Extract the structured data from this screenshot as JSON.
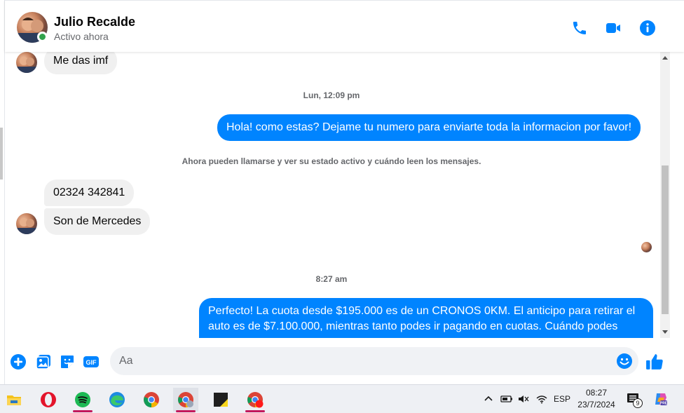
{
  "header": {
    "contact_name": "Julio Recalde",
    "status": "Activo ahora"
  },
  "messages": {
    "first_in": "Me das imf",
    "time_1": "Lun, 12:09 pm",
    "out_1": "Hola! como estas? Dejame tu numero para enviarte toda la informacion por favor!",
    "system_note": "Ahora pueden llamarse y ver su estado activo y cuándo leen los mensajes.",
    "in_phone": "02324 342841",
    "in_mercedes": "Son de Mercedes",
    "time_2": "8:27 am",
    "out_2_line1": "Perfecto! La cuota desde $195.000 es de un CRONOS 0KM. El anticipo para retirar el",
    "out_2_line2": "auto es de $7.100.000, mientras tanto podes ir pagando en cuotas. Cuándo podes"
  },
  "composer": {
    "placeholder": "Aa"
  },
  "taskbar": {
    "language": "ESP",
    "time": "08:27",
    "date": "23/7/2024",
    "notification_count": "9"
  },
  "colors": {
    "accent": "#0084ff",
    "online": "#31a24c",
    "incoming_bubble": "#f0f0f0"
  }
}
